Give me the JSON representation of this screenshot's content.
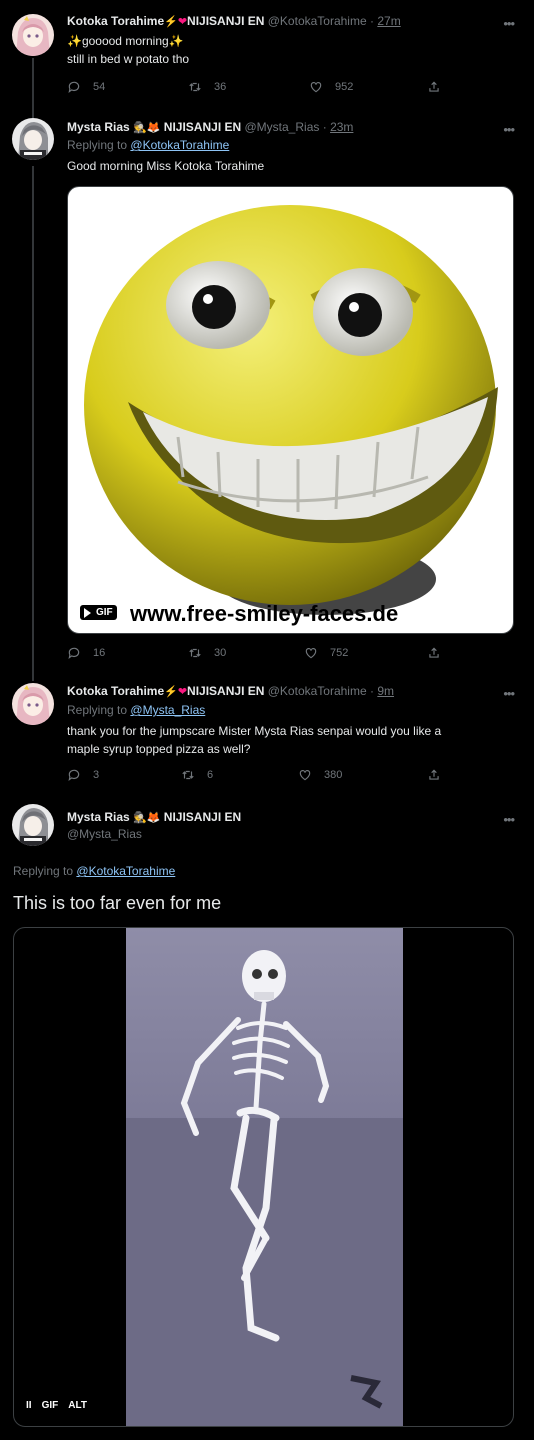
{
  "tweets": [
    {
      "name": "Kotoka Torahime",
      "affiliation": "NIJISANJI EN",
      "handle": "@KotokaTorahime",
      "time": "27m",
      "text_line1": "✨gooood morning✨",
      "text_line2": "still in bed w potato tho",
      "replies": "54",
      "retweets": "36",
      "likes": "952"
    },
    {
      "name": "Mysta Rias",
      "affiliation": "NIJISANJI EN",
      "handle": "@Mysta_Rias",
      "time": "23m",
      "replying_prefix": "Replying to",
      "replying_to": "@KotokaTorahime",
      "text": "Good morning Miss Kotoka Torahime",
      "media_badge": "GIF",
      "watermark": "www.free-smiley-faces.de",
      "replies": "16",
      "retweets": "30",
      "likes": "752"
    },
    {
      "name": "Kotoka Torahime",
      "affiliation": "NIJISANJI EN",
      "handle": "@KotokaTorahime",
      "time": "9m",
      "replying_prefix": "Replying to",
      "replying_to": "@Mysta_Rias",
      "text_line1": "thank you for the jumpscare Mister Mysta Rias senpai would you like a",
      "text_line2": "maple syrup topped pizza as well?",
      "replies": "3",
      "retweets": "6",
      "likes": "380"
    },
    {
      "name": "Mysta Rias",
      "affiliation": "NIJISANJI EN",
      "handle": "@Mysta_Rias",
      "replying_prefix": "Replying to",
      "replying_to": "@KotokaTorahime",
      "text": "This is too far even for me",
      "media_badge": "GIF",
      "media_alt": "ALT",
      "pause_glyph": "II"
    }
  ],
  "separator": "·",
  "more_glyph": "•••",
  "colors": {
    "background": "#000000",
    "text": "#e7e9ea",
    "muted": "#71767b",
    "link": "#8ec4f5",
    "border": "#3c4043",
    "heart": "#f91880",
    "lightning": "#ffac33"
  }
}
